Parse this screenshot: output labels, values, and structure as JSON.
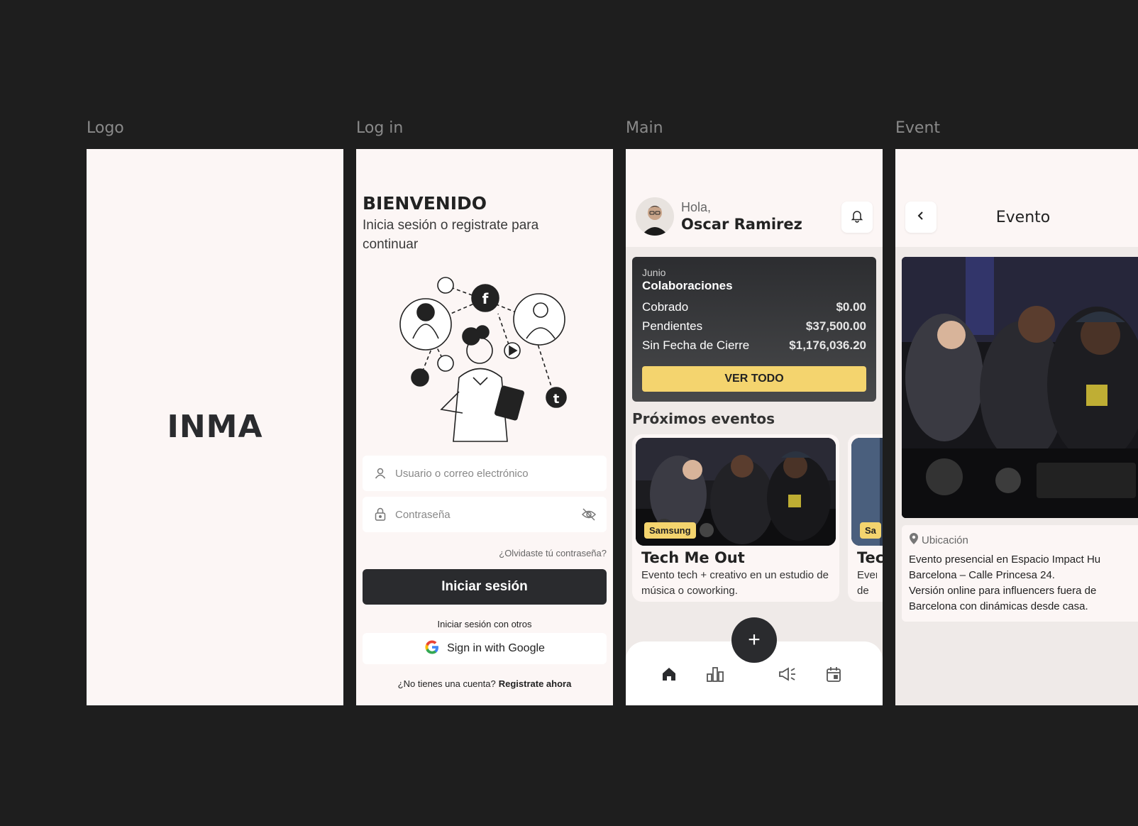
{
  "frames": {
    "logo_label": "Logo",
    "login_label": "Log in",
    "main_label": "Main",
    "event_label": "Event"
  },
  "logo": {
    "text": "INMA"
  },
  "login": {
    "title": "BIENVENIDO",
    "subtitle": "Inicia sesión o registrate para continuar",
    "username_placeholder": "Usuario o correo electrónico",
    "password_placeholder": "Contraseña",
    "forgot": "¿Olvidaste tú contraseña?",
    "login_button": "Iniciar sesión",
    "others_label": "Iniciar sesión con otros",
    "google_button": "Sign in with Google",
    "no_account": "¿No tienes una cuenta?",
    "register_link": "Registrate ahora"
  },
  "main": {
    "greeting": "Hola,",
    "user_name": "Oscar Ramirez",
    "card": {
      "month": "Junio",
      "title": "Colaboraciones",
      "rows": [
        {
          "label": "Cobrado",
          "value": "$0.00"
        },
        {
          "label": "Pendientes",
          "value": "$37,500.00"
        },
        {
          "label": "Sin Fecha de Cierre",
          "value": "$1,176,036.20"
        }
      ],
      "button": "VER TODO"
    },
    "section_title": "Próximos eventos",
    "events": [
      {
        "badge": "Samsung",
        "name": "Tech Me Out",
        "desc": "Evento tech + creativo en un estudio de música o coworking."
      },
      {
        "badge": "Sa",
        "name": "Tec",
        "desc": "Ever de m"
      }
    ],
    "fab": "+",
    "nav_icons": [
      "home-icon",
      "chart-icon",
      "megaphone-icon",
      "calendar-icon"
    ]
  },
  "event": {
    "title": "Evento",
    "location_label": "Ubicación",
    "lines": [
      "Evento presencial en Espacio Impact Hu",
      "Barcelona – Calle Princesa 24.",
      "Versión online para influencers fuera de",
      "Barcelona con dinámicas desde casa."
    ]
  },
  "colors": {
    "background": "#1e1e1e",
    "surface": "#fcf6f5",
    "dark": "#2a2b2e",
    "accent": "#f4d46e"
  }
}
